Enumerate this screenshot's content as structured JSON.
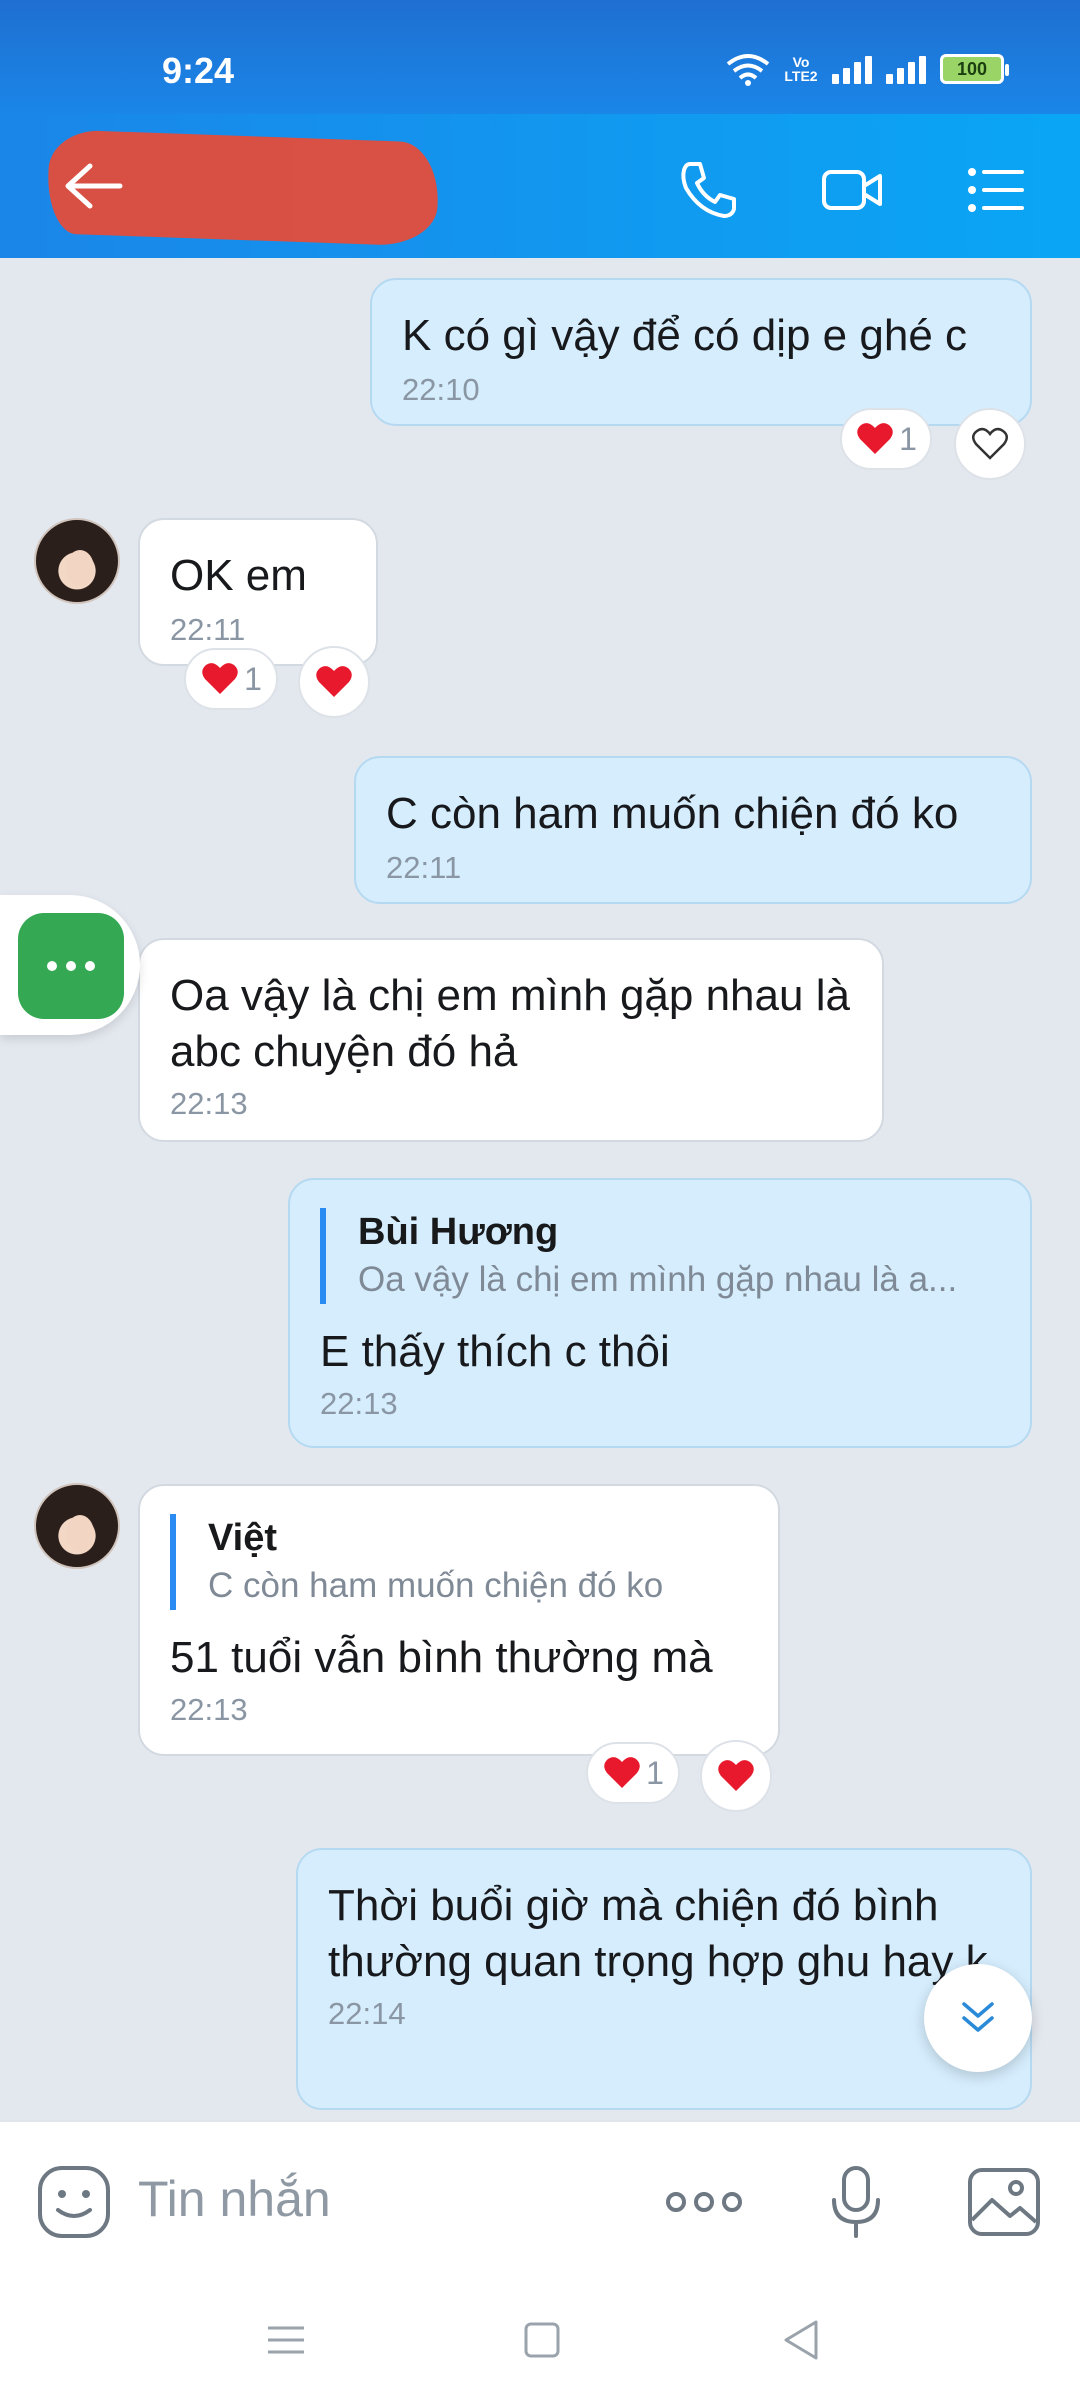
{
  "status_bar": {
    "time": "9:24",
    "lte_label": "Vo LTE2",
    "battery": "100"
  },
  "header": {
    "contact_name_redacted": ""
  },
  "messages": [
    {
      "id": "m1",
      "direction": "out",
      "text": "K có gì vậy để có dịp e ghé c",
      "time": "22:10",
      "reaction_count": "1"
    },
    {
      "id": "m2",
      "direction": "in",
      "text": "OK em",
      "time": "22:11",
      "reaction_count": "1"
    },
    {
      "id": "m3",
      "direction": "out",
      "text": "C còn ham muốn chiện đó ko",
      "time": "22:11"
    },
    {
      "id": "m4",
      "direction": "in",
      "text": "Oa vậy là chị em mình gặp nhau là abc chuyện đó hả",
      "time": "22:13"
    },
    {
      "id": "m5",
      "direction": "out",
      "quote_name": "Bùi Hương",
      "quote_text": "Oa vậy là chị em mình gặp nhau là a...",
      "text": "E thấy thích c thôi",
      "time": "22:13"
    },
    {
      "id": "m6",
      "direction": "in",
      "quote_name": "Việt",
      "quote_text": "C còn ham muốn chiện đó ko",
      "text": "51 tuổi vẫn bình thường mà",
      "time": "22:13",
      "reaction_count": "1"
    },
    {
      "id": "m7",
      "direction": "out",
      "text": "Thời buổi giờ mà chiện đó bình thường quan trọng hợp ghu hay k",
      "time": "22:14"
    }
  ],
  "composer": {
    "placeholder": "Tin nhắn"
  },
  "colors": {
    "header": "#1a86e8",
    "outgoing_bubble": "#d5edfd",
    "incoming_bubble": "#ffffff",
    "chat_background": "#e3e8ef",
    "heart": "#e8192c",
    "quote_bar": "#2a8bf2"
  },
  "icons": [
    "back-arrow-icon",
    "phone-icon",
    "video-call-icon",
    "menu-list-icon",
    "heart-icon",
    "heart-outline-icon",
    "more-dots-icon",
    "scroll-down-icon",
    "sticker-icon",
    "more-options-icon",
    "microphone-icon",
    "image-icon",
    "nav-recents-icon",
    "nav-home-icon",
    "nav-back-icon"
  ]
}
